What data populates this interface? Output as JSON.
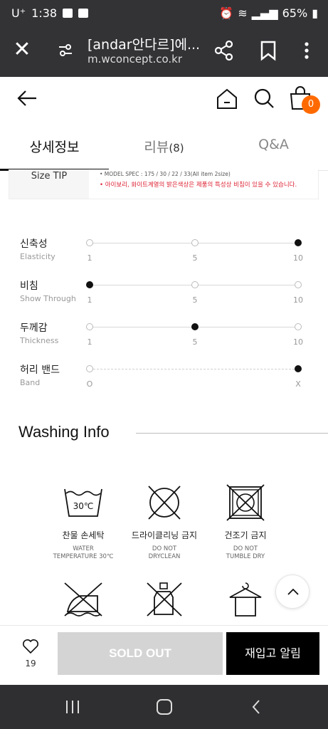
{
  "status_bar": {
    "carrier": "U⁺",
    "time": "1:38",
    "battery": "65%"
  },
  "browser": {
    "page_title": "[andar안다르]에...",
    "url": "m.wconcept.co.kr"
  },
  "header": {
    "cart_count": "0"
  },
  "tabs": [
    {
      "label": "상세정보",
      "active": true
    },
    {
      "label": "리뷰",
      "count": "(8)",
      "active": false
    },
    {
      "label": "Q&A",
      "active": false
    }
  ],
  "size_tip": {
    "label": "Size TIP",
    "spec": "• MODEL SPEC : 175 / 30 / 22 / 33(All item 2size)",
    "warning": "• 아이보리, 화이트계열의 밝은색상은 제품의 특성상 비침이 있을 수 있습니다."
  },
  "attributes": [
    {
      "kr": "신축성",
      "en": "Elasticity",
      "scale": [
        "1",
        "5",
        "10"
      ],
      "selected_index": 2
    },
    {
      "kr": "비침",
      "en": "Show Through",
      "scale": [
        "1",
        "5",
        "10"
      ],
      "selected_index": 0
    },
    {
      "kr": "두께감",
      "en": "Thickness",
      "scale": [
        "1",
        "5",
        "10"
      ],
      "selected_index": 1
    },
    {
      "kr": "허리 밴드",
      "en": "Band",
      "scale": [
        "O",
        "X"
      ],
      "selected_index": 2
    }
  ],
  "washing": {
    "title": "Washing Info",
    "items": [
      {
        "kr": "찬물 손세탁",
        "en1": "WATER",
        "en2": "TEMPERATURE 30℃",
        "icon": "hand-wash-30-icon",
        "temp": "30℃"
      },
      {
        "kr": "드라이클리닝 금지",
        "en1": "DO NOT",
        "en2": "DRYCLEAN",
        "icon": "no-dryclean-icon"
      },
      {
        "kr": "건조기 금지",
        "en1": "DO NOT",
        "en2": "TUMBLE DRY",
        "icon": "no-tumble-dry-icon"
      },
      {
        "icon": "no-iron-icon"
      },
      {
        "icon": "no-bleach-icon"
      },
      {
        "icon": "hang-dry-icon"
      }
    ]
  },
  "action_bar": {
    "like_count": "19",
    "soldout_label": "SOLD OUT",
    "restock_label": "재입고 알림"
  }
}
